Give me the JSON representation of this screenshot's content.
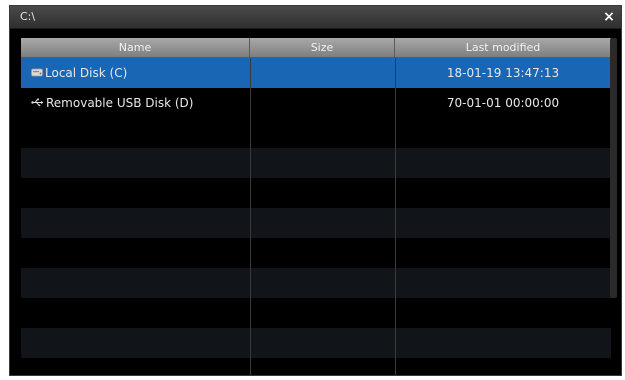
{
  "window": {
    "title": "C:\\",
    "close_glyph": "×"
  },
  "table": {
    "columns": [
      "Name",
      "Size",
      "Last modified"
    ],
    "rows": [
      {
        "icon": "hard-disk-icon",
        "name": "Local Disk (C)",
        "size": "",
        "modified": "18-01-19 13:47:13",
        "selected": true
      },
      {
        "icon": "usb-icon",
        "name": "Removable USB Disk (D)",
        "size": "",
        "modified": "70-01-01 00:00:00",
        "selected": false
      }
    ]
  },
  "colors": {
    "selection": "#1866b4",
    "background": "#000000",
    "stripe": "#111418"
  }
}
